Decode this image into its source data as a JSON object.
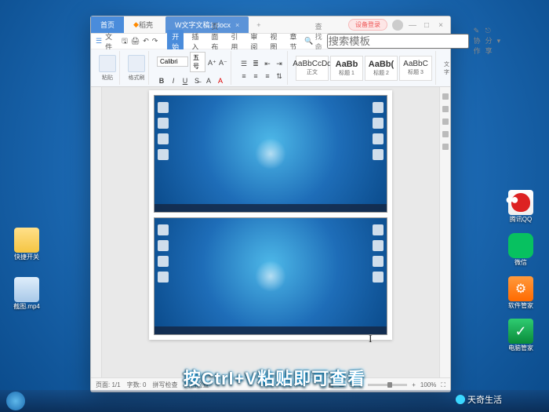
{
  "desktop": {
    "left_icons": [
      {
        "label": "快捷开关",
        "cls": "folder"
      },
      {
        "label": "截图.mp4",
        "cls": "recycle"
      }
    ],
    "right_icons": [
      {
        "label": "腾讯QQ",
        "cls": "qq"
      },
      {
        "label": "微信",
        "cls": "wechat"
      },
      {
        "label": "软件管家",
        "cls": "orange"
      },
      {
        "label": "电脑管家",
        "cls": "guard"
      }
    ]
  },
  "app": {
    "tabs": {
      "home": "首页",
      "secondary": "稻壳",
      "doc": "文字文稿1.docx",
      "plus": "+"
    },
    "login": "设备登录",
    "menubar": {
      "file": "文件",
      "items": [
        "开始",
        "插入",
        "页面布局",
        "引用",
        "审阅",
        "视图",
        "章节"
      ],
      "active": "开始",
      "search_placeholder": "搜索模板",
      "search_action": "查找命令",
      "coop": "协作",
      "share": "分享"
    },
    "ribbon": {
      "paste": "粘贴",
      "brush": "格式刷",
      "font": "Calibri",
      "size": "五号",
      "styles": [
        {
          "sample": "AaBbCcDd",
          "name": "正文"
        },
        {
          "sample": "AaBb",
          "name": "标题 1"
        },
        {
          "sample": "AaBb(",
          "name": "标题 2"
        },
        {
          "sample": "AaBbC",
          "name": "标题 3"
        }
      ],
      "text_group": "文字"
    },
    "status": {
      "page": "页面: 1/1",
      "words": "字数: 0",
      "spell": "拼写检查",
      "doc_check": "文档检查",
      "zoom": "100%"
    }
  },
  "subtitle": "按Ctrl+V粘贴即可查看",
  "watermark": "天奇生活"
}
